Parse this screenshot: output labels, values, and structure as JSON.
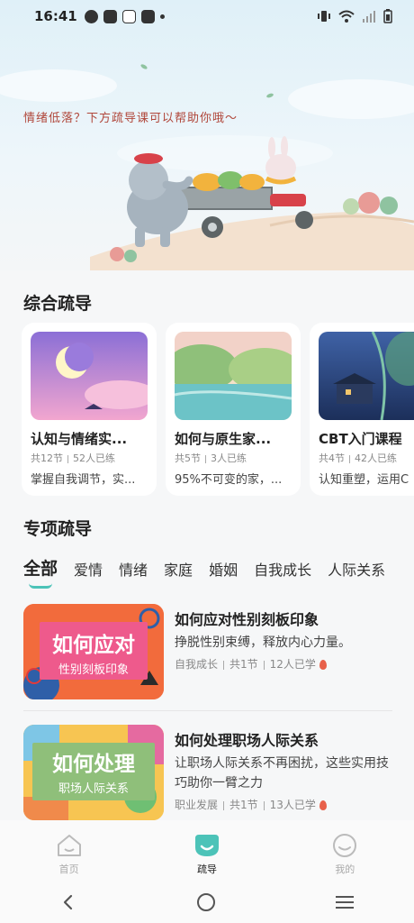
{
  "status": {
    "time": "16:41"
  },
  "hero": {
    "caption": "情绪低落？下方疏导课可以帮助你哦～"
  },
  "general": {
    "title": "综合疏导",
    "cards": [
      {
        "title": "认知与情绪实...",
        "lessons": "共12节",
        "learners": "52人已练",
        "desc": "掌握自我调节，实..."
      },
      {
        "title": "如何与原生家...",
        "lessons": "共5节",
        "learners": "3人已练",
        "desc": "95%不可变的家，..."
      },
      {
        "title": "CBT入门课程",
        "lessons": "共4节",
        "learners": "42人已练",
        "desc": "认知重塑，运用C"
      }
    ]
  },
  "special": {
    "title": "专项疏导",
    "tabs": [
      "全部",
      "爱情",
      "情绪",
      "家庭",
      "婚姻",
      "自我成长",
      "人际关系"
    ],
    "items": [
      {
        "thumb_main": "如何应对",
        "thumb_sub": "性别刻板印象",
        "title": "如何应对性别刻板印象",
        "desc": "挣脱性别束缚，释放内心力量。",
        "category": "自我成长",
        "lessons": "共1节",
        "learners": "12人已学"
      },
      {
        "thumb_main": "如何处理",
        "thumb_sub": "职场人际关系",
        "title": "如何处理职场人际关系",
        "desc": "让职场人际关系不再困扰，这些实用技巧助你一臂之力",
        "category": "职业发展",
        "lessons": "共1节",
        "learners": "13人已学"
      }
    ]
  },
  "nav": {
    "home": "首页",
    "guide": "疏导",
    "me": "我的"
  },
  "colors": {
    "accent": "#4cc3b8",
    "flame": "#e8604a"
  }
}
